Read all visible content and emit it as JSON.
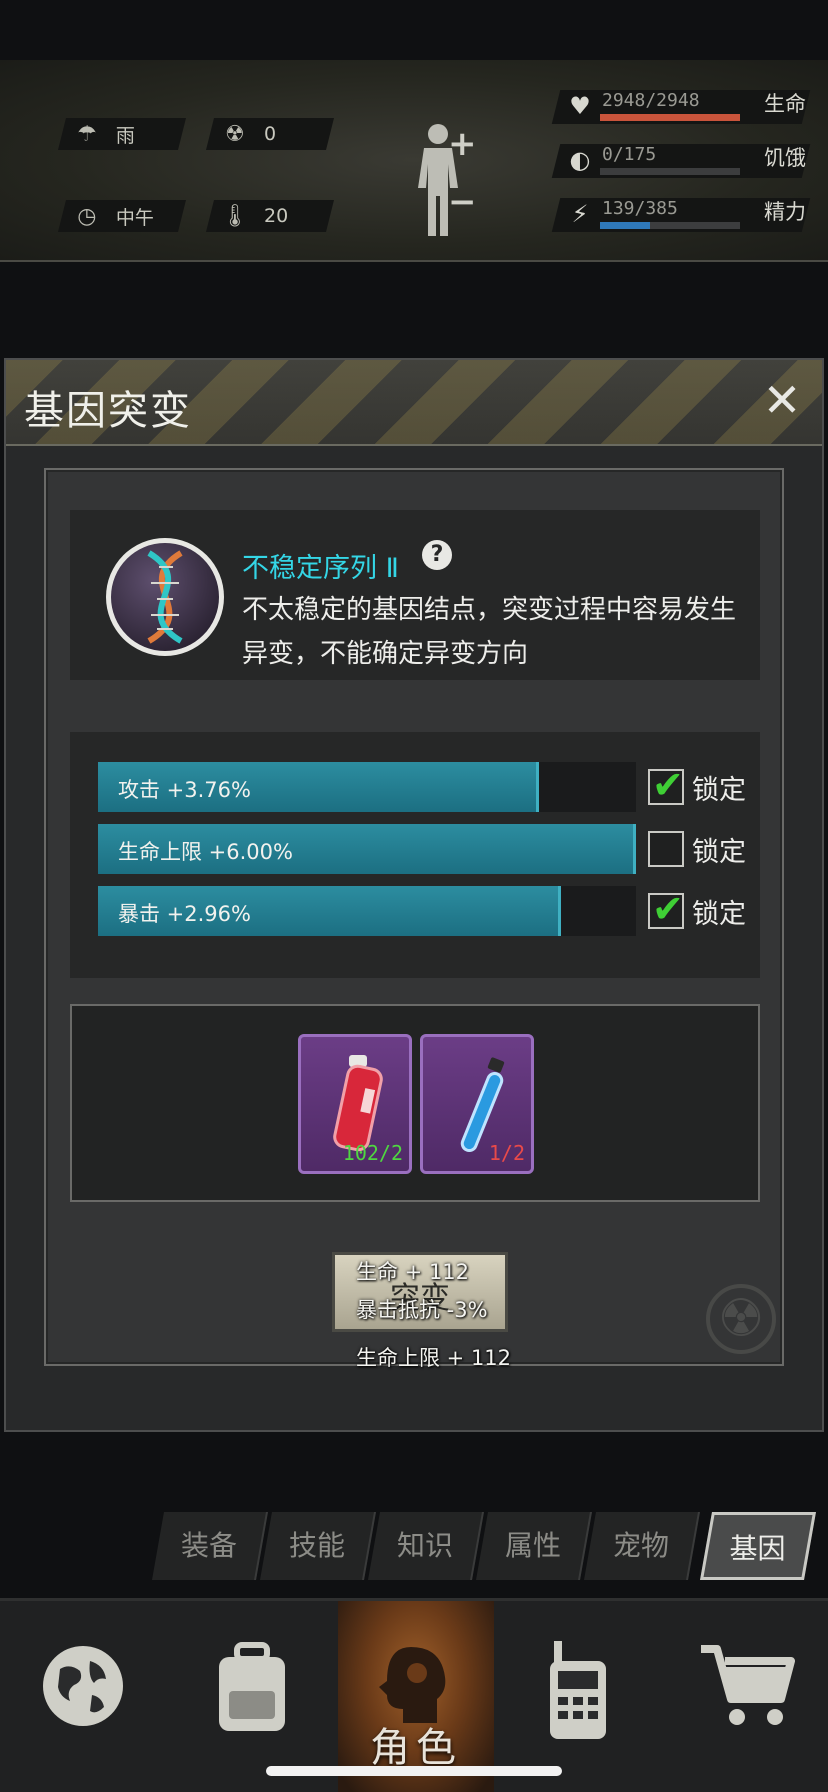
{
  "status": {
    "weather": {
      "icon": "rain-cloud-icon",
      "value": "雨"
    },
    "radiation": {
      "icon": "radiation-icon",
      "value": "0"
    },
    "time": {
      "icon": "clock-icon",
      "value": "中午"
    },
    "temperature": {
      "icon": "thermometer-icon",
      "value": "20"
    },
    "vitals": [
      {
        "icon": "heart-icon",
        "value": "2948/2948",
        "label": "生命",
        "fraction": 1.0,
        "color": "#c9543b"
      },
      {
        "icon": "stomach-icon",
        "value": "0/175",
        "label": "饥饿",
        "fraction": 0.0,
        "color": "#8a8a84"
      },
      {
        "icon": "energy-head-icon",
        "value": "139/385",
        "label": "精力",
        "fraction": 0.36,
        "color": "#2f78b8"
      }
    ],
    "body_plus": "+",
    "body_minus": "−"
  },
  "dialog": {
    "title": "基因突变",
    "close": "✕",
    "gene": {
      "name": "不稳定序列 Ⅱ",
      "help": "?",
      "description": "不太稳定的基因结点，突变过程中容易发生异变，不能确定异变方向"
    },
    "attributes": [
      {
        "text": "攻击 +3.76%",
        "fraction": 0.82,
        "locked": true,
        "lock_label": "锁定"
      },
      {
        "text": "生命上限 +6.00%",
        "fraction": 1.0,
        "locked": false,
        "lock_label": "锁定"
      },
      {
        "text": "暴击 +2.96%",
        "fraction": 0.86,
        "locked": true,
        "lock_label": "锁定"
      }
    ],
    "items": [
      {
        "icon": "red-vial-icon",
        "count": "102/2",
        "count_color": "#4fd641"
      },
      {
        "icon": "blue-test-tube-icon",
        "count": "1/2",
        "count_color": "#e84a4a"
      }
    ],
    "mutate_label": "突变",
    "floating": {
      "line1": "生命 + 112",
      "line2": "暴击抵抗 -3%",
      "line3": "生命上限 + 112"
    }
  },
  "tabs": [
    {
      "label": "装备",
      "active": false
    },
    {
      "label": "技能",
      "active": false
    },
    {
      "label": "知识",
      "active": false
    },
    {
      "label": "属性",
      "active": false
    },
    {
      "label": "宠物",
      "active": false
    },
    {
      "label": "基因",
      "active": true
    }
  ],
  "nav": [
    {
      "icon": "globe-icon",
      "label": "",
      "active": false
    },
    {
      "icon": "backpack-icon",
      "label": "",
      "active": false
    },
    {
      "icon": "character-head-icon",
      "label": "角色",
      "active": true
    },
    {
      "icon": "walkie-talkie-icon",
      "label": "",
      "active": false
    },
    {
      "icon": "shopping-cart-icon",
      "label": "",
      "active": false
    }
  ]
}
